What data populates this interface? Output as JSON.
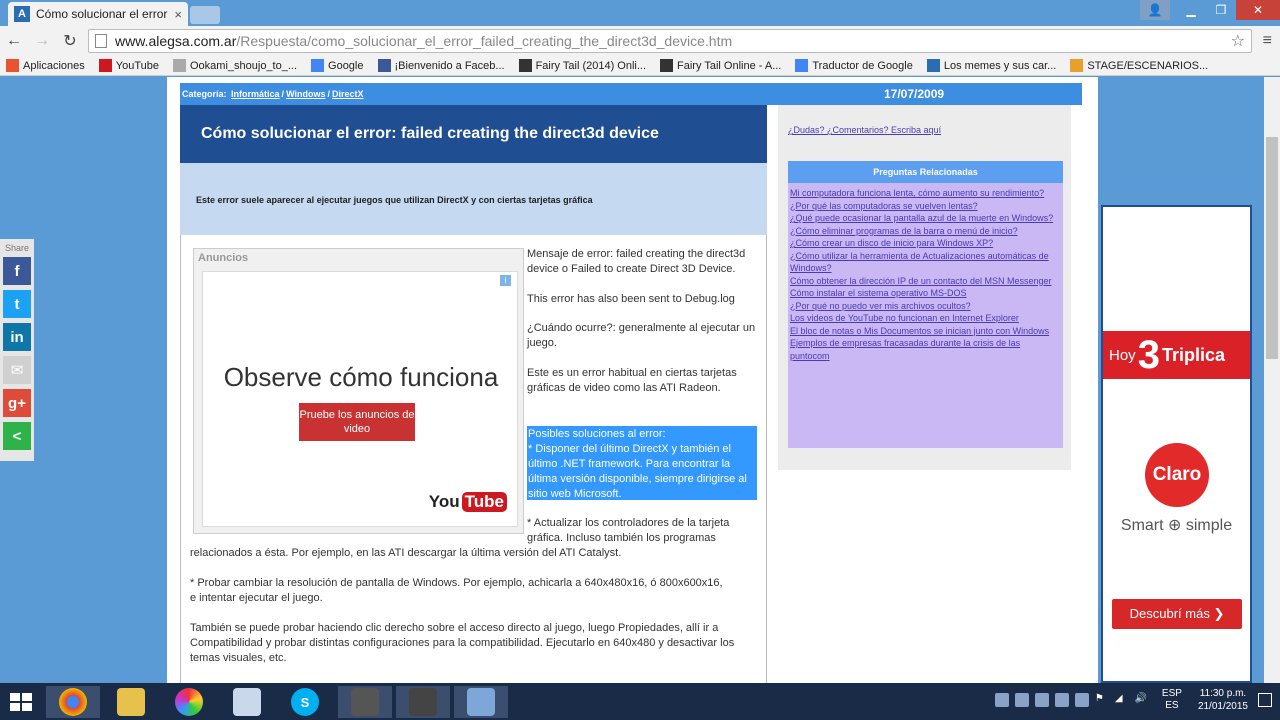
{
  "browser": {
    "tab_title": "Cómo solucionar el error",
    "tab_close": "×",
    "url_host": "www.alegsa.com.ar",
    "url_path": "/Respuesta/como_solucionar_el_error_failed_creating_the_direct3d_device.htm",
    "bookmarks": [
      {
        "label": "Aplicaciones",
        "icon": "apps-grid-icon",
        "color": "#e8542d"
      },
      {
        "label": "YouTube",
        "icon": "youtube-icon",
        "color": "#cc181e"
      },
      {
        "label": "Ookami_shoujo_to_...",
        "icon": "page-icon",
        "color": "#aaaaaa"
      },
      {
        "label": "Google",
        "icon": "google-icon",
        "color": "#4285f4"
      },
      {
        "label": "¡Bienvenido a Faceb...",
        "icon": "facebook-icon",
        "color": "#3b5998"
      },
      {
        "label": "Fairy Tail (2014) Onli...",
        "icon": "fairytail-icon",
        "color": "#333333"
      },
      {
        "label": "Fairy Tail Online - A...",
        "icon": "fairytail-icon",
        "color": "#333333"
      },
      {
        "label": "Traductor de Google",
        "icon": "translate-icon",
        "color": "#4285f4"
      },
      {
        "label": "Los memes y sus car...",
        "icon": "ti-icon",
        "color": "#2a6db3"
      },
      {
        "label": "STAGE/ESCENARIOS...",
        "icon": "stage-icon",
        "color": "#e8a02d"
      }
    ]
  },
  "page": {
    "category_label": "Categoría:",
    "categories": [
      "Informática",
      "Windows",
      "DirectX"
    ],
    "sep": "/",
    "date": "17/07/2009",
    "title": "Cómo solucionar el error: failed creating the direct3d device",
    "summary": "Este error suele aparecer al ejecutar juegos que utilizan DirectX y con ciertas tarjetas gráfica",
    "ad": {
      "label": "Anuncios",
      "info": "i",
      "headline": "Observe cómo funciona",
      "button": "Pruebe los anuncios de video",
      "brand_you": "You",
      "brand_tube": "Tube"
    },
    "p1": "Mensaje de error: failed creating the direct3d device o Failed to create Direct 3D Device.",
    "p1b": "This error has also been sent to Debug.log",
    "p2": "¿Cuándo ocurre?: generalmente al ejecutar un juego.",
    "p3": "Este es un error habitual en ciertas tarjetas gráficas de video como las ATI Radeon.",
    "p4_title": "Posibles soluciones al error:",
    "p4_body": "* Disponer del último DirectX y también el último .NET framework. Para encontrar la última versión disponible, siempre dirigirse al sitio web Microsoft.",
    "p5a": "* Actualizar los controladores de la tarjeta gráfica. Incluso también los programas",
    "p5b": "relacionados a ésta. Por ejemplo, en las ATI descargar la última versión del ATI Catalyst.",
    "p6": "* Probar cambiar la resolución de pantalla de Windows. Por ejemplo, achicarla a 640x480x16, ó 800x600x16, e intentar ejecutar el juego.",
    "p7": "También se puede probar haciendo clic derecho sobre el acceso directo al juego, luego Propiedades, allí ir a Compatibilidad y probar distintas configuraciones para la compatibilidad. Ejecutarlo en 640x480 y desactivar los temas visuales, etc."
  },
  "sidebar": {
    "ask_link": "¿Dudas? ¿Comentarios? Escriba aquí",
    "related_title": "Preguntas Relacionadas",
    "related": [
      "Mi computadora funciona lenta, cómo aumento su rendimiento?",
      "¿Por qué las computadoras se vuelven lentas?",
      "¿Qué puede ocasionar la pantalla azul de la muerte en Windows?",
      "¿Cómo eliminar programas de la barra o menú de inicio?",
      "¿Cómo crear un disco de inicio para Windows XP?",
      "¿Cómo utilizar la herramienta de Actualizaciones automáticas de Windows?",
      "Cómo obtener la dirección IP de un contacto del MSN Messenger",
      "Cómo instalar el sistema operativo MS-DOS",
      "¿Por qué no puedo ver mis archivos ocultos?",
      "Los videos de YouTube no funcionan en Internet Explorer",
      "El bloc de notas o Mis Documentos se inician junto con Windows",
      "Ejemplos de empresas fracasadas durante la crisis de las puntocom"
    ]
  },
  "right_ad": {
    "hoy": "Hoy",
    "three": "3",
    "triplica": "Triplica",
    "brand": "Claro",
    "tagline": "Smart ⊕ simple",
    "cta": "Descubrí más ❯"
  },
  "share": {
    "label": "Share",
    "buttons": [
      {
        "name": "facebook-share-button",
        "glyph": "f",
        "color": "#3b5998"
      },
      {
        "name": "twitter-share-button",
        "glyph": "t",
        "color": "#1da1f2"
      },
      {
        "name": "linkedin-share-button",
        "glyph": "in",
        "color": "#0e76a8"
      },
      {
        "name": "email-share-button",
        "glyph": "✉",
        "color": "#d0d0d0"
      },
      {
        "name": "googleplus-share-button",
        "glyph": "g+",
        "color": "#dd4b39"
      },
      {
        "name": "more-share-button",
        "glyph": "<",
        "color": "#2db34a"
      }
    ]
  },
  "taskbar": {
    "lang_top": "ESP",
    "lang_bottom": "ES",
    "time": "11:30 p.m.",
    "date": "21/01/2015"
  }
}
